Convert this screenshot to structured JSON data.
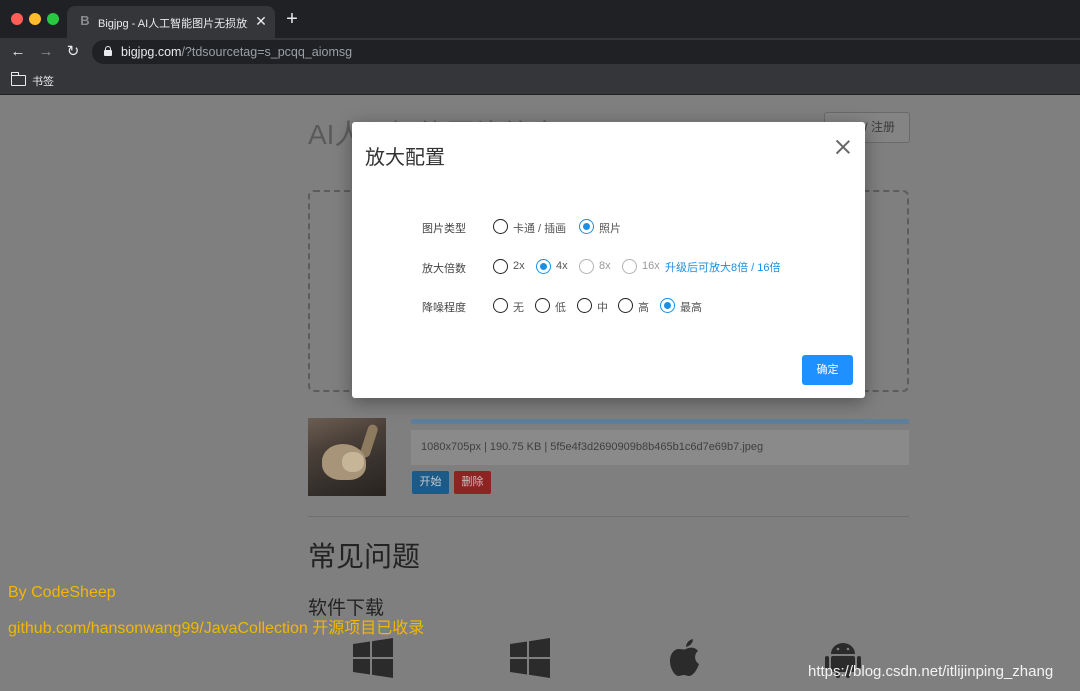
{
  "browser": {
    "tab_title": "Bigjpg - AI人工智能图片无损放大",
    "tab_favicon": "B",
    "url_host": "bigjpg.com",
    "url_path": "/?tdsourcetag=s_pcqq_aiomsg",
    "bookmarks_label": "书签"
  },
  "page": {
    "title": "AI人工智能图片放大",
    "login_label": "/ 注册",
    "file_info": "1080x705px | 190.75 KB | 5f5e4f3d2690909b8b465b1c6d7e69b7.jpeg",
    "start_label": "开始",
    "delete_label": "删除",
    "faq_title": "常见问题",
    "download_title": "软件下载"
  },
  "modal": {
    "title": "放大配置",
    "image_type": {
      "label": "图片类型",
      "options": [
        {
          "label": "卡通 / 插画",
          "checked": false
        },
        {
          "label": "照片",
          "checked": true
        }
      ]
    },
    "scale": {
      "label": "放大倍数",
      "options": [
        {
          "label": "2x",
          "checked": false,
          "disabled": false
        },
        {
          "label": "4x",
          "checked": true,
          "disabled": false
        },
        {
          "label": "8x",
          "checked": false,
          "disabled": true
        },
        {
          "label": "16x",
          "checked": false,
          "disabled": true
        }
      ],
      "upgrade_link": "升级后可放大8倍 / 16倍"
    },
    "noise": {
      "label": "降噪程度",
      "options": [
        {
          "label": "无",
          "checked": false
        },
        {
          "label": "低",
          "checked": false
        },
        {
          "label": "中",
          "checked": false
        },
        {
          "label": "高",
          "checked": false
        },
        {
          "label": "最高",
          "checked": true
        }
      ]
    },
    "confirm_label": "确定"
  },
  "watermarks": {
    "line1": "By CodeSheep",
    "line2": "github.com/hansonwang99/JavaCollection 开源项目已收录",
    "csdn": "https://blog.csdn.net/itlijinping_zhang"
  },
  "colors": {
    "accent": "#1a8fe3",
    "watermark": "#f2b705"
  }
}
